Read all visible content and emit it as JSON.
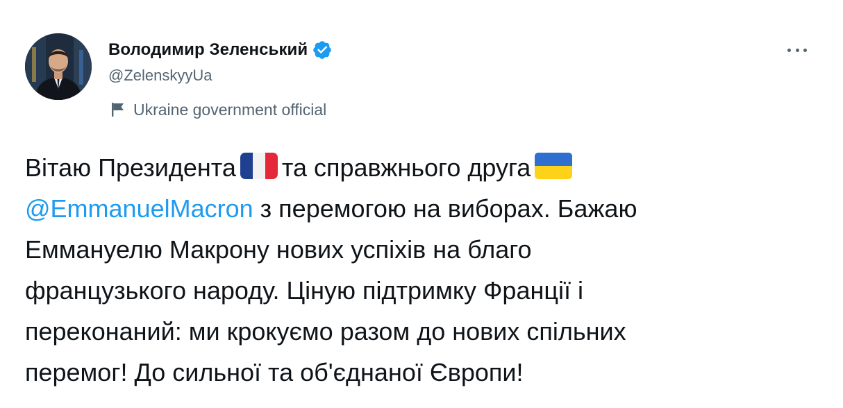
{
  "author": {
    "name": "Володимир Зеленський",
    "handle": "@ZelenskyyUa",
    "label": "Ukraine government official",
    "verified": true
  },
  "tweet": {
    "line1_a": "Вітаю Президента",
    "line1_b": "та справжнього друга",
    "mention": "@EmmanuelMacron",
    "line2_rest": " з перемогою на виборах. Бажаю",
    "line3": "Еммануелю Макрону нових успіхів на благо",
    "line4": "французького народу. Ціную підтримку Франції і",
    "line5": "переконаний: ми крокуємо разом до нових спільних",
    "line6": "перемог! До сильної та об'єднаної Європи!",
    "emoji": [
      "france-flag",
      "ukraine-flag"
    ]
  },
  "colors": {
    "link": "#1d9bf0",
    "secondary_text": "#536471",
    "verified_badge": "#1d9bf0"
  },
  "icons": [
    "verified-badge-icon",
    "government-flag-icon",
    "more-options-icon"
  ]
}
